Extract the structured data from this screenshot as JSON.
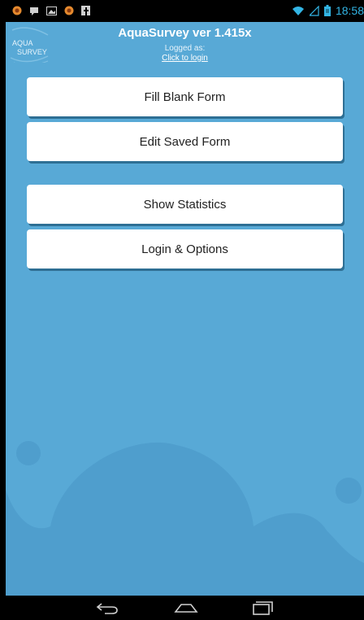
{
  "status_bar": {
    "time": "18:58",
    "left_icons": [
      "app-badge-icon",
      "message-icon",
      "image-icon",
      "app-badge-icon",
      "facebook-icon"
    ],
    "right_icons": [
      "wifi-icon",
      "signal-icon",
      "battery-icon"
    ],
    "accent_color": "#33b5e5"
  },
  "logo": {
    "line1": "AQUA",
    "line2": "SURVEY"
  },
  "header": {
    "title": "AquaSurvey ver 1.415x",
    "logged_as": "Logged as:",
    "login_link": "Click to login"
  },
  "menu": {
    "fill_blank_form": "Fill Blank Form",
    "edit_saved_form": "Edit Saved Form",
    "show_statistics": "Show Statistics",
    "login_options": "Login & Options"
  },
  "nav_bar": {
    "icons": [
      "back-icon",
      "home-icon",
      "recent-apps-icon"
    ]
  },
  "colors": {
    "background": "#58a9d6",
    "background_dark": "#4f9ecd",
    "button": "#ffffff",
    "button_shadow": "#2e6f94"
  }
}
